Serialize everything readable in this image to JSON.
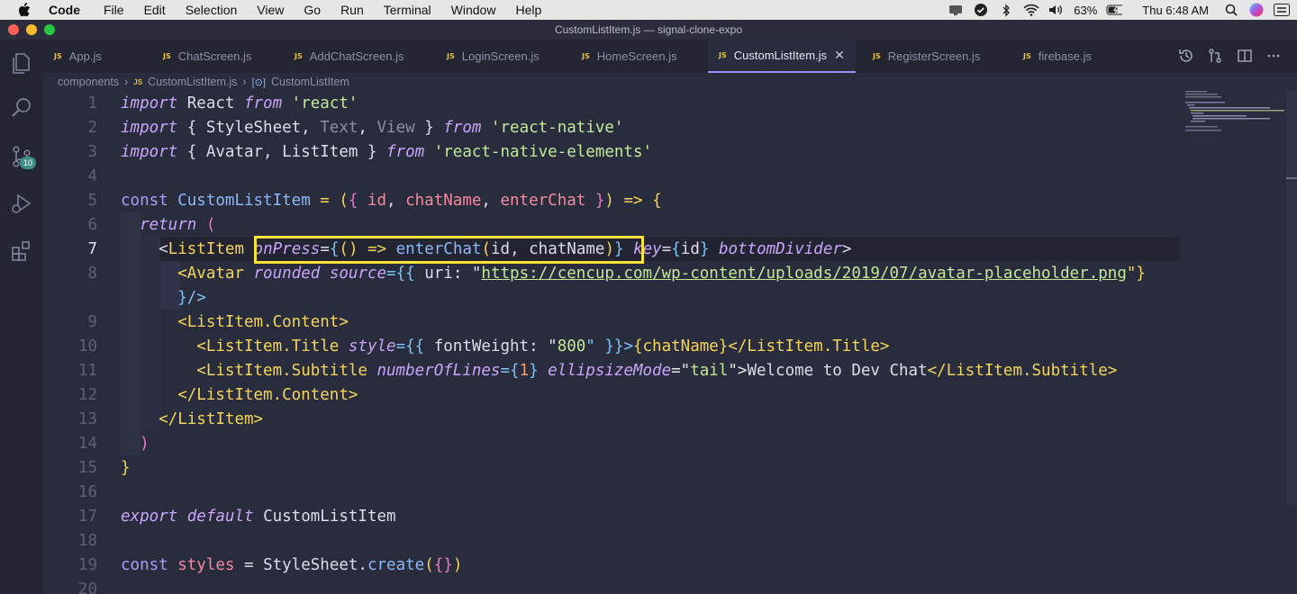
{
  "menubar": {
    "app": "Code",
    "items": [
      "File",
      "Edit",
      "Selection",
      "View",
      "Go",
      "Run",
      "Terminal",
      "Window",
      "Help"
    ],
    "battery": "63%",
    "clock": "Thu 6:48 AM"
  },
  "window": {
    "title": "CustomListItem.js — signal-clone-expo"
  },
  "activity": {
    "scm_badge": "10"
  },
  "tabs": [
    {
      "label": "App.js",
      "icon": "js-file-icon"
    },
    {
      "label": "ChatScreen.js",
      "icon": "js-file-icon"
    },
    {
      "label": "AddChatScreen.js",
      "icon": "js-file-icon"
    },
    {
      "label": "LoginScreen.js",
      "icon": "js-file-icon"
    },
    {
      "label": "HomeScreen.js",
      "icon": "js-file-icon"
    },
    {
      "label": "CustomListItem.js",
      "icon": "js-file-icon",
      "active": true
    },
    {
      "label": "RegisterScreen.js",
      "icon": "js-file-icon"
    },
    {
      "label": "firebase.js",
      "icon": "js-file-icon"
    }
  ],
  "breadcrumb": {
    "folder": "components",
    "file": "CustomListItem.js",
    "symbol": "CustomListItem"
  },
  "editor": {
    "current_line": 7,
    "line_numbers": [
      "1",
      "2",
      "3",
      "4",
      "5",
      "6",
      "7",
      "8",
      "9",
      "10",
      "11",
      "12",
      "13",
      "14",
      "15",
      "16",
      "17",
      "18",
      "19",
      "20"
    ],
    "code": {
      "l1": {
        "a": "import",
        "b": " React ",
        "c": "from",
        "d": " 'react'"
      },
      "l2": {
        "a": "import",
        "b": " { StyleSheet, ",
        "t": "Text",
        "u": ", ",
        "v": "View",
        "w": " } ",
        "c": "from",
        "d": " 'react-native'"
      },
      "l3": {
        "a": "import",
        "b": " { Avatar, ListItem } ",
        "c": "from",
        "d": " 'react-native-elements'"
      },
      "l5": {
        "a": "const",
        "b": " CustomListItem ",
        "c": "= (",
        "d": "{",
        "e": " id",
        "f": ", ",
        "g": "chatName",
        "h": ", ",
        "i": "enterChat",
        "j": " }",
        "k": ") => {"
      },
      "l6": {
        "a": "return",
        "b": " ("
      },
      "l7": {
        "a": "<",
        "b": "ListItem",
        "c": " ",
        "d": "onPress",
        "e": "=",
        "f": "{",
        "g": "() => ",
        "h": "enterChat",
        "i": "(",
        "j": "id, chatName",
        "k": ")",
        "l": "}",
        "m": " ",
        "n": "key",
        "o": "=",
        "p": "{",
        "q": "id",
        "r": "}",
        "s": " bottomDivider",
        "t": ">"
      },
      "l8": {
        "a": "<Avatar ",
        "b": "rounded",
        "c": " ",
        "d": "source",
        "e": "={{ ",
        "f": "uri",
        "g": ": \"",
        "h": "https://cencup.com/wp-content/uploads/2019/07/avatar-placeholder.png",
        "i": "\"}"
      },
      "l8b": {
        "a": "}/>"
      },
      "l9": {
        "a": "<ListItem.Content>"
      },
      "l10": {
        "a": "<ListItem.Title ",
        "b": "style",
        "c": "={{ ",
        "d": "fontWeight",
        "e": ": \"",
        "f": "800",
        "g": "\" }}>",
        "h": "{chatName}",
        "i": "</ListItem.Title>"
      },
      "l11": {
        "a": "<ListItem.Subtitle ",
        "b": "numberOfLines",
        "c": "={",
        "d": "1",
        "e": "} ",
        "f": "ellipsizeMode",
        "g": "=\"",
        "h": "tail",
        "i": "\">",
        "j": "Welcome to Dev Chat",
        "k": "</ListItem.Subtitle>"
      },
      "l12": {
        "a": "</ListItem.Content>"
      },
      "l13": {
        "a": "</ListItem>"
      },
      "l14": {
        "a": ")"
      },
      "l15": {
        "a": "}"
      },
      "l17": {
        "a": "export",
        "b": " ",
        "c": "default",
        "d": " CustomListItem"
      },
      "l19": {
        "a": "const",
        "b": " styles ",
        "c": "=",
        "d": " StyleSheet.",
        "e": "create",
        "f": "(",
        "g": "{}",
        "h": ")"
      }
    }
  }
}
